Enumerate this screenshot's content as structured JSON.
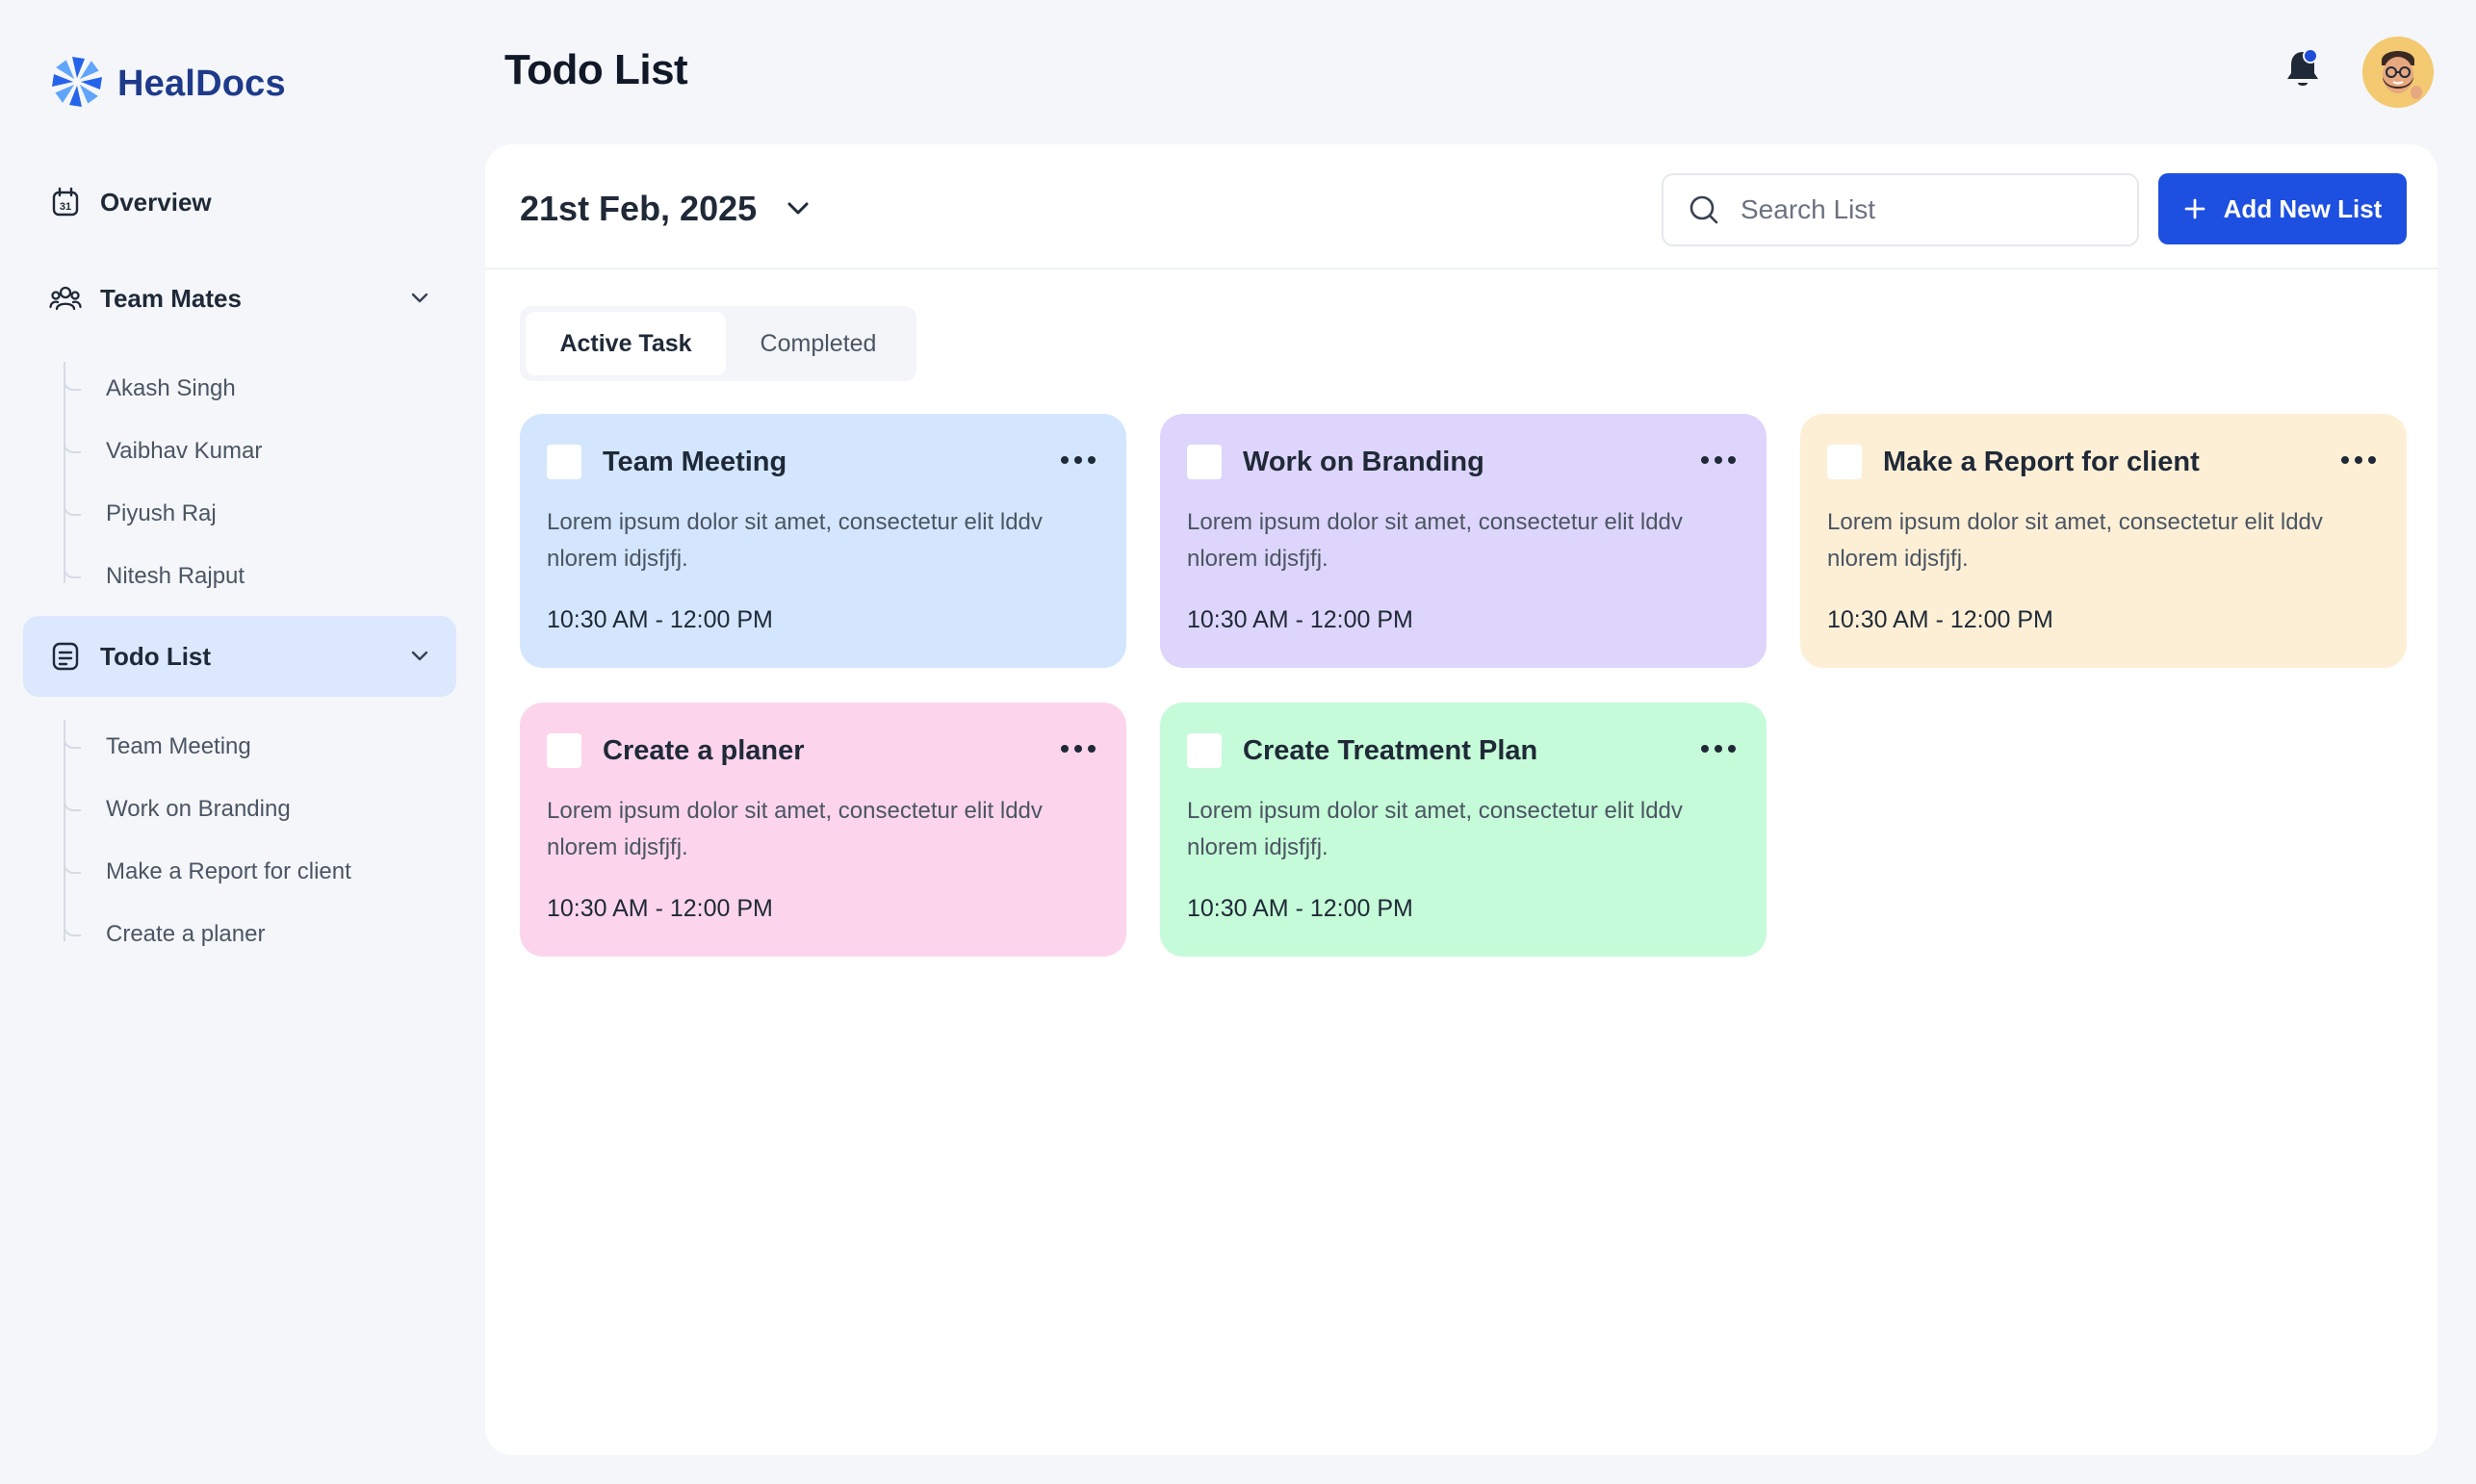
{
  "brand": {
    "name": "HealDocs"
  },
  "sidebar": {
    "overview_label": "Overview",
    "team_mates": {
      "label": "Team Mates",
      "members": [
        "Akash Singh",
        "Vaibhav Kumar",
        "Piyush Raj",
        "Nitesh Rajput"
      ]
    },
    "todo": {
      "label": "Todo List",
      "items": [
        "Team Meeting",
        "Work on Branding",
        "Make a Report for client",
        "Create a planer"
      ]
    }
  },
  "header": {
    "title": "Todo List"
  },
  "toolbar": {
    "date": "21st Feb, 2025",
    "search_placeholder": "Search List",
    "add_label": "Add New List"
  },
  "tabs": {
    "active": "Active Task",
    "completed": "Completed"
  },
  "cards": [
    {
      "title": "Team Meeting",
      "desc": "Lorem ipsum dolor sit amet, consectetur elit lddv nlorem idjsfjfj.",
      "time": "10:30 AM - 12:00 PM",
      "color": "#d3e6fd"
    },
    {
      "title": "Work on Branding",
      "desc": "Lorem ipsum dolor sit amet, consectetur elit lddv nlorem idjsfjfj.",
      "time": "10:30 AM - 12:00 PM",
      "color": "#ddd5fb"
    },
    {
      "title": "Make a Report for client",
      "desc": "Lorem ipsum dolor sit amet, consectetur elit lddv nlorem idjsfjfj.",
      "time": "10:30 AM - 12:00 PM",
      "color": "#fdefd5"
    },
    {
      "title": "Create a planer",
      "desc": "Lorem ipsum dolor sit amet, consectetur elit lddv nlorem idjsfjfj.",
      "time": "10:30 AM - 12:00 PM",
      "color": "#fcd5ec"
    },
    {
      "title": "Create Treatment Plan",
      "desc": "Lorem ipsum dolor sit amet, consectetur elit lddv nlorem idjsfjfj.",
      "time": "10:30 AM - 12:00 PM",
      "color": "#c5fbd8"
    }
  ],
  "colors": {
    "accent": "#1d4fe0",
    "nav_active_bg": "#dbe8fd",
    "brand_text": "#1e3a8a"
  }
}
